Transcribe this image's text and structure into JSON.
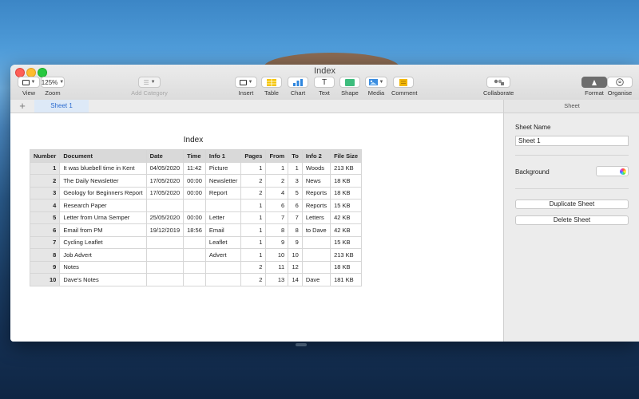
{
  "window": {
    "title": "Index"
  },
  "toolbar": {
    "view_label": "View",
    "zoom_value": "125%",
    "zoom_label": "Zoom",
    "add_category_label": "Add Category",
    "insert_label": "Insert",
    "table_label": "Table",
    "chart_label": "Chart",
    "text_label": "Text",
    "shape_label": "Shape",
    "media_label": "Media",
    "comment_label": "Comment",
    "collaborate_label": "Collaborate",
    "format_label": "Format",
    "organise_label": "Organise",
    "icons": [
      "sidebar-icon",
      "list-icon",
      "insert-icon",
      "table-icon",
      "chart-icon",
      "text-icon",
      "shape-icon",
      "media-icon",
      "comment-icon",
      "collaborate-icon",
      "format-brush-icon",
      "organise-icon"
    ]
  },
  "tabs": {
    "add_symbol": "+",
    "sheets": [
      "Sheet 1"
    ]
  },
  "table": {
    "title": "Index",
    "headers": [
      "Number",
      "Document",
      "Date",
      "Time",
      "Info 1",
      "Pages",
      "From",
      "To",
      "Info 2",
      "File Size"
    ],
    "rows": [
      [
        "1",
        "It was bluebell time in Kent",
        "04/05/2020",
        "11:42",
        "Picture",
        "1",
        "1",
        "1",
        "Woods",
        "213 KB"
      ],
      [
        "2",
        "The Daily Newsletter",
        "17/05/2020",
        "00:00",
        "Newsletter",
        "2",
        "2",
        "3",
        "News",
        "18 KB"
      ],
      [
        "3",
        "Geology for Beginners Report",
        "17/05/2020",
        "00:00",
        "Report",
        "2",
        "4",
        "5",
        "Reports",
        "18 KB"
      ],
      [
        "4",
        "Research Paper",
        "",
        "",
        "",
        "1",
        "6",
        "6",
        "Reports",
        "15 KB"
      ],
      [
        "5",
        "Letter from Urna Semper",
        "25/05/2020",
        "00:00",
        "Letter",
        "1",
        "7",
        "7",
        "Letters",
        "42 KB"
      ],
      [
        "6",
        "Email from PM",
        "19/12/2019",
        "18:56",
        "Email",
        "1",
        "8",
        "8",
        "to Dave",
        "42 KB"
      ],
      [
        "7",
        "Cycling Leaflet",
        "",
        "",
        "Leaflet",
        "1",
        "9",
        "9",
        "",
        "15 KB"
      ],
      [
        "8",
        "Job Advert",
        "",
        "",
        "Advert",
        "1",
        "10",
        "10",
        "",
        "213 KB"
      ],
      [
        "9",
        "Notes",
        "",
        "",
        "",
        "2",
        "11",
        "12",
        "",
        "18 KB"
      ],
      [
        "10",
        "Dave's Notes",
        "",
        "",
        "",
        "2",
        "13",
        "14",
        "Dave",
        "181 KB"
      ]
    ]
  },
  "sidebar": {
    "header": "Sheet",
    "sheet_name_label": "Sheet Name",
    "sheet_name_value": "Sheet 1",
    "background_label": "Background",
    "duplicate_label": "Duplicate Sheet",
    "delete_label": "Delete Sheet"
  },
  "colors": {
    "accent": "#2c6cd0",
    "close": "#fe5f57",
    "minimize": "#febc2e",
    "maximize": "#28c840"
  }
}
